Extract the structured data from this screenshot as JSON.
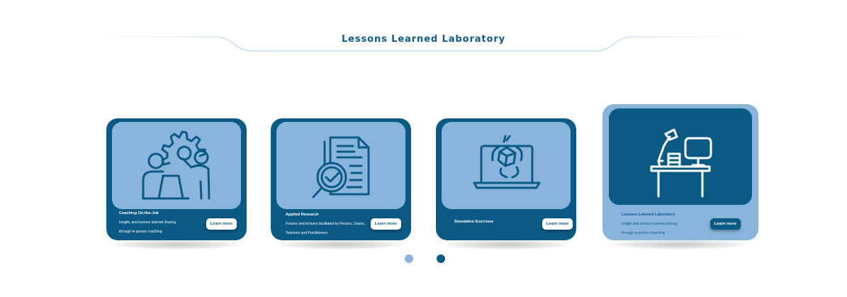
{
  "header": {
    "title": "Lessons Learned Laboratory"
  },
  "cards": [
    {
      "title": "Coaching On-the-Job",
      "desc_lines": [
        "Insight, and lessons learned sharing",
        "through in-person coaching"
      ],
      "button": "Learn more",
      "icon": "coaching-gears-people-icon"
    },
    {
      "title": "Applied Research",
      "desc_lines": [
        "Forums and lectures facilitated by Rectors, Deans,",
        "Teachers and Practitioners"
      ],
      "button": "Learn more",
      "icon": "research-document-magnifier-icon"
    },
    {
      "title": "Simulation Exercises",
      "desc_lines": [],
      "button": "Learn more",
      "icon": "laptop-cube-simulation-icon"
    },
    {
      "title": "Lessons Learned Laboratory",
      "desc_lines": [
        "Insight and lessons learned sharing",
        "through in-person coaching"
      ],
      "button": "Learn more",
      "icon": "desk-lamp-monitor-icon"
    }
  ],
  "pagination": {
    "pages": 2,
    "active_page": 2
  },
  "colors": {
    "primary": "#0b5a86",
    "light": "#89b5dd",
    "title": "#0f5a86"
  }
}
